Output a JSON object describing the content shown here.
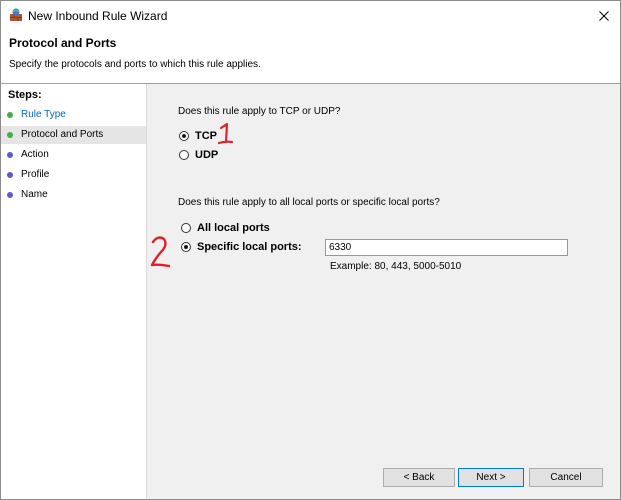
{
  "window": {
    "title": "New Inbound Rule Wizard"
  },
  "header": {
    "title": "Protocol and Ports",
    "subtitle": "Specify the protocols and ports to which this rule applies."
  },
  "sidebar": {
    "steps_label": "Steps:",
    "items": [
      {
        "label": "Rule Type",
        "dot_color": "#3cb043"
      },
      {
        "label": "Protocol and Ports",
        "dot_color": "#3cb043"
      },
      {
        "label": "Action",
        "dot_color": "#5a5ad0"
      },
      {
        "label": "Profile",
        "dot_color": "#5a5ad0"
      },
      {
        "label": "Name",
        "dot_color": "#5a5ad0"
      }
    ]
  },
  "main": {
    "protocol_question": "Does this rule apply to TCP or UDP?",
    "tcp_label": "TCP",
    "udp_label": "UDP",
    "ports_question": "Does this rule apply to all local ports or specific local ports?",
    "all_ports_label": "All local ports",
    "specific_ports_label": "Specific local ports:",
    "port_value": "6330",
    "example_text": "Example: 80, 443, 5000-5010"
  },
  "buttons": {
    "back": "< Back",
    "next": "Next >",
    "cancel": "Cancel"
  },
  "annotations": {
    "mark_1": "1",
    "mark_2": "2",
    "color": "#e0202a"
  },
  "icons": {
    "app": "firewall-icon",
    "close": "close-icon"
  }
}
